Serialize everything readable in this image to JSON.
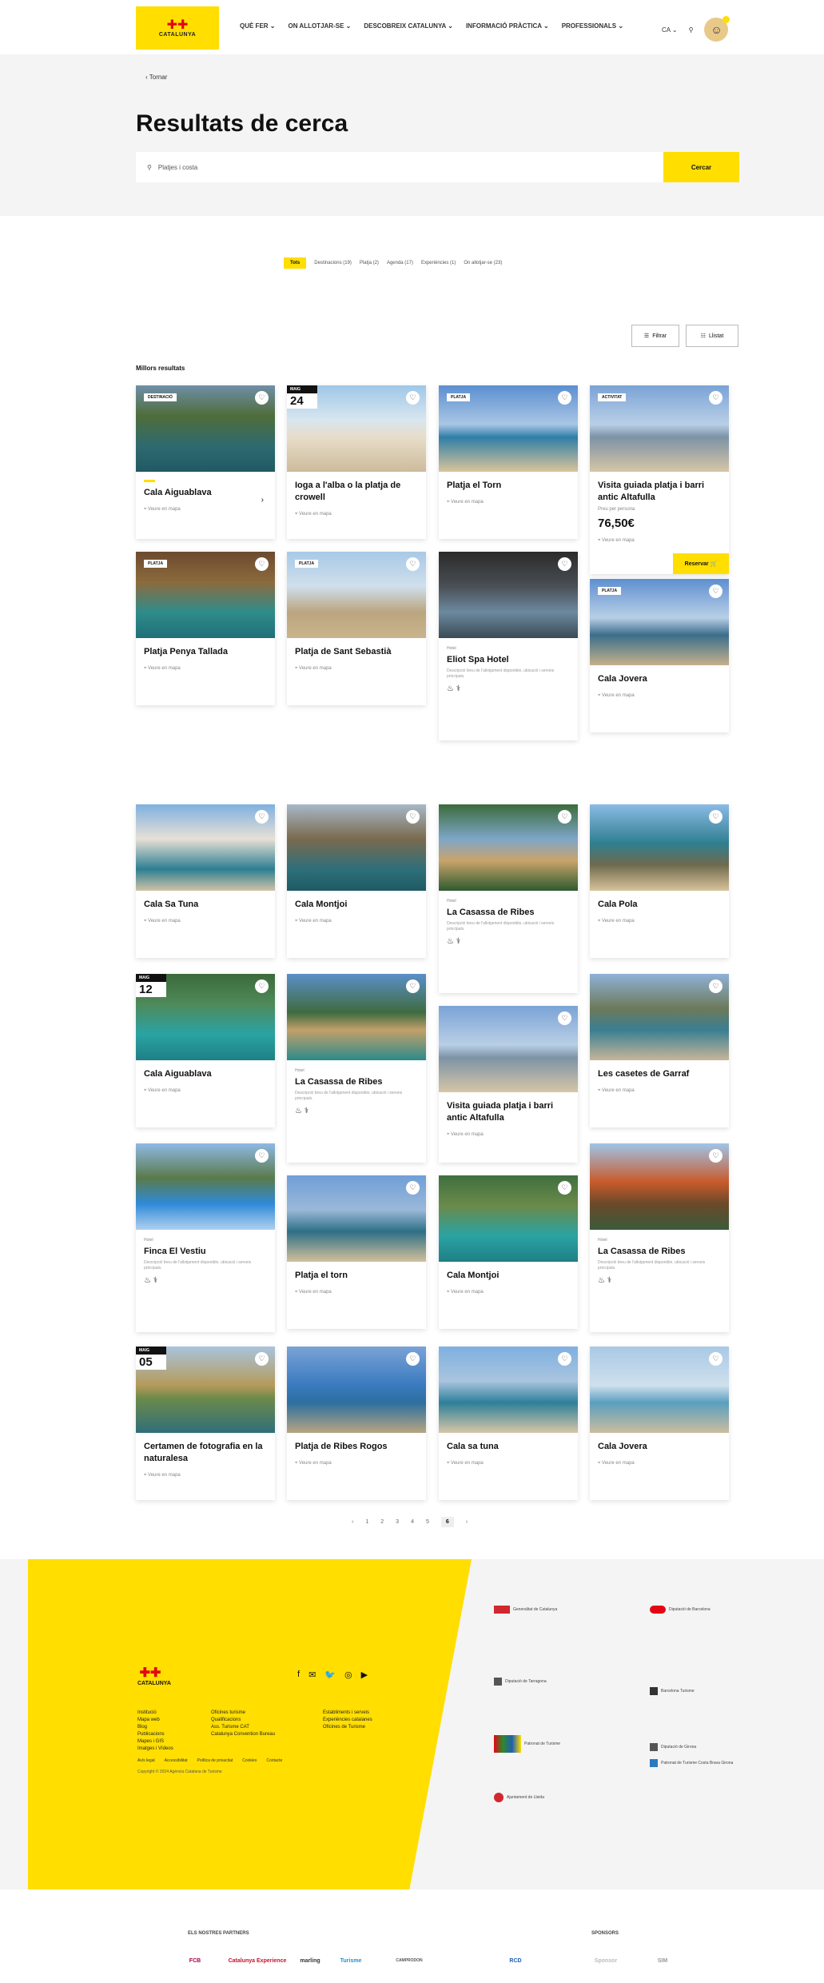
{
  "header": {
    "logo_text": "CATALUNYA",
    "logo_mark": "✚✚",
    "nav": [
      "QUÈ FER ⌄",
      "ON ALLOTJAR-SE ⌄",
      "DESCOBREIX CATALUNYA ⌄",
      "INFORMACIÓ PRÀCTICA ⌄",
      "PROFESSIONALS ⌄"
    ],
    "lang": "CA ⌄"
  },
  "hero": {
    "back": "‹ Tornar",
    "title": "Resultats de cerca",
    "search_value": "Platjes i costa",
    "search_button": "Cercar"
  },
  "filters": [
    "Tots",
    "Destinacions (19)",
    "Platja (2)",
    "Agenda (17)",
    "Experiències (1)",
    "On allotjar-se (23)"
  ],
  "toolbar": {
    "filter": "Filtrar",
    "view": "Llistat"
  },
  "best_label": "Millors resultats",
  "cards": [
    {
      "title": "Cala Aiguablava",
      "tag": "DESTINACIÓ",
      "meta": "Veure en mapa",
      "arrow": "›",
      "img": "a"
    },
    {
      "title": "Ioga a l'alba o la platja de crowell",
      "month": "MAIG",
      "day": "24",
      "meta": "Veure en mapa",
      "img": "b"
    },
    {
      "title": "Platja el Torn",
      "tag": "PLATJA",
      "meta": "Veure en mapa",
      "img": "c"
    },
    {
      "title": "Visita guiada platja i barri antic Altafulla",
      "tag": "ACTIVITAT",
      "price_label": "Preu per persona",
      "price": "76,50€",
      "meta": "Veure en mapa",
      "reserve": "Reservar 🛒",
      "img": "d"
    },
    {
      "title": "Platja Penya Tallada",
      "tag": "PLATJA",
      "meta": "Veure en mapa",
      "img": "e"
    },
    {
      "title": "Platja de Sant Sebastià",
      "tag": "PLATJA",
      "meta": "Veure en mapa",
      "img": "f"
    },
    {
      "title": "Eliot Spa Hotel",
      "cat": "Hotel",
      "desc": "Descripció breu de l'allotjament disponible, ubicació i serveis principals.",
      "icons": "♨ ⚕",
      "img": "g"
    },
    {
      "title": "Cala Jovera",
      "tag": "PLATJA",
      "meta": "Veure en mapa",
      "img": "h"
    },
    {
      "title": "Cala Sa Tuna",
      "meta": "Veure en mapa",
      "img": "i"
    },
    {
      "title": "Cala Montjoi",
      "meta": "Veure en mapa",
      "img": "j"
    },
    {
      "title": "La Casassa de Ribes",
      "cat": "Hotel",
      "desc": "Descripció breu de l'allotjament disponible, ubicació i serveis principals.",
      "icons": "♨ ⚕",
      "img": "k"
    },
    {
      "title": "Cala Pola",
      "meta": "Veure en mapa",
      "img": "l"
    },
    {
      "title": "Cala Aiguablava",
      "month": "MAIG",
      "day": "12",
      "meta": "Veure en mapa",
      "img": "m"
    },
    {
      "title": "La Casassa de Ribes",
      "cat": "Hotel",
      "desc": "Descripció breu de l'allotjament disponible, ubicació i serveis principals.",
      "icons": "♨ ⚕",
      "img": "n"
    },
    {
      "title": "Visita guiada platja i barri antic Altafulla",
      "meta": "Veure en mapa",
      "img": "o"
    },
    {
      "title": "Les casetes de Garraf",
      "meta": "Veure en mapa",
      "img": "p"
    },
    {
      "title": "Finca El Vestiu",
      "cat": "Hotel",
      "desc": "Descripció breu de l'allotjament disponible, ubicació i serveis principals.",
      "icons": "♨ ⚕",
      "img": "q"
    },
    {
      "title": "Platja el torn",
      "meta": "Veure en mapa",
      "img": "r"
    },
    {
      "title": "Cala Montjoi",
      "meta": "Veure en mapa",
      "img": "s"
    },
    {
      "title": "La Casassa de Ribes",
      "cat": "Hotel",
      "desc": "Descripció breu de l'allotjament disponible, ubicació i serveis principals.",
      "icons": "♨ ⚕",
      "img": "t"
    },
    {
      "title": "Certamen de fotografia en la naturalesa",
      "month": "MAIG",
      "day": "05",
      "meta": "Veure en mapa",
      "img": "u"
    },
    {
      "title": "Platja de Ribes Rogos",
      "meta": "Veure en mapa",
      "img": "v"
    },
    {
      "title": "Cala sa tuna",
      "meta": "Veure en mapa",
      "img": "w"
    },
    {
      "title": "Cala Jovera",
      "meta": "Veure en mapa",
      "img": "x"
    }
  ],
  "pagination": [
    "‹",
    "1",
    "2",
    "3",
    "4",
    "5",
    "6",
    "›"
  ],
  "footer": {
    "logo_text": "CATALUNYA",
    "logo_mark": "✚✚",
    "social": [
      "f",
      "✉",
      "🐦",
      "◎",
      "▶"
    ],
    "col1": [
      "Institució",
      "Mapa web",
      "Blog",
      "Publicacions",
      "Mapes i GIS",
      "Imatges i Vídeos"
    ],
    "col2": [
      "Oficines turisme",
      "Qualificacions",
      "Ass. Turisme CAT",
      "Catalunya Convention Bureau"
    ],
    "col3": [
      "Establiments i serveis",
      "Experiències catalanes",
      "Oficines de Turisme"
    ],
    "links": [
      "Avís legal",
      "Accessibilitat",
      "Política de privacitat",
      "Cookies",
      "Contacte"
    ],
    "copyright": "Copyright © 2024 Agència Catalana de Turisme",
    "institutions": [
      "Generalitat de Catalunya",
      "Diputació de Barcelona",
      "Diputació de Tarragona",
      "Barcelona Turisme",
      "Patronat de Turisme",
      "Diputació de Girona",
      "Patronat de Turisme Costa Brava Girona",
      "Ajuntament de Lleida"
    ],
    "partners_label": "ELS NOSTRES PARTNERS",
    "partners": [
      "FCB",
      "Catalunya Experience",
      "marling",
      "Turisme",
      "CAMPRODON",
      "RCD"
    ],
    "sponsors_label": "SPONSORS",
    "sponsors": [
      "Sponsor",
      "SIM"
    ]
  }
}
